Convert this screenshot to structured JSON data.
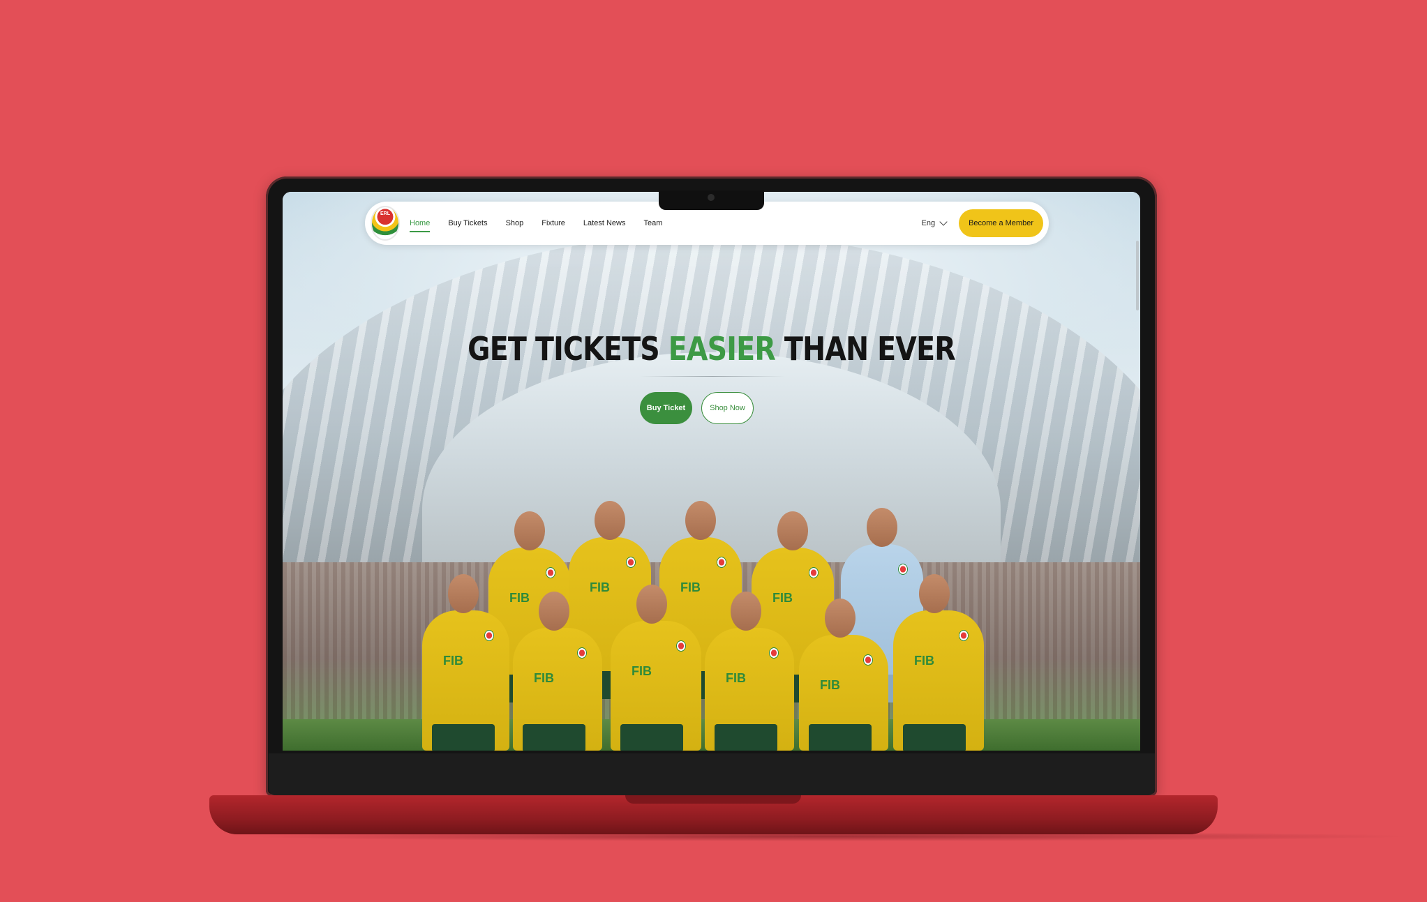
{
  "colors": {
    "background": "#e34f57",
    "accent_green": "#3d9a45",
    "member_yellow": "#f0c419"
  },
  "logo": {
    "text": "ERL",
    "icon": "club-crest-icon"
  },
  "nav": {
    "items": [
      {
        "label": "Home",
        "active": true
      },
      {
        "label": "Buy Tickets"
      },
      {
        "label": "Shop"
      },
      {
        "label": "Fixture"
      },
      {
        "label": "Latest News"
      },
      {
        "label": "Team"
      }
    ],
    "language": "Eng",
    "member_button": "Become a Member"
  },
  "hero": {
    "title_part1": "GET TICKETS ",
    "title_highlight": "EASIER",
    "title_part2": " THAN EVER",
    "buy_button": "Buy Ticket",
    "shop_button": "Shop Now"
  },
  "team_photo": {
    "sponsor": "FIB"
  }
}
